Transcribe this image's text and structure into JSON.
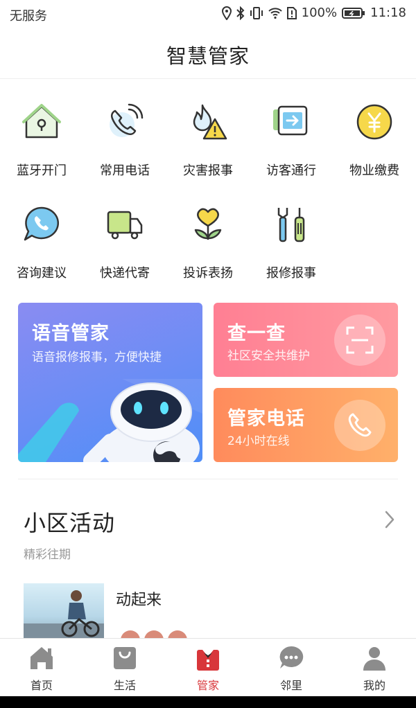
{
  "status": {
    "carrier": "无服务",
    "battery": "100%",
    "time": "11:18"
  },
  "header": {
    "title": "智慧管家"
  },
  "grid": [
    {
      "label": "蓝牙开门",
      "icon": "house-lock-icon"
    },
    {
      "label": "常用电话",
      "icon": "phone-icon"
    },
    {
      "label": "灾害报事",
      "icon": "fire-warning-icon"
    },
    {
      "label": "访客通行",
      "icon": "visitor-pass-icon"
    },
    {
      "label": "物业缴费",
      "icon": "yen-coin-icon"
    },
    {
      "label": "咨询建议",
      "icon": "chat-phone-icon"
    },
    {
      "label": "快递代寄",
      "icon": "delivery-truck-icon"
    },
    {
      "label": "投诉表扬",
      "icon": "heart-flower-icon"
    },
    {
      "label": "报修报事",
      "icon": "repair-tools-icon"
    }
  ],
  "cards": {
    "voice": {
      "title": "语音管家",
      "subtitle": "语音报修报事，方便快捷"
    },
    "check": {
      "title": "查一查",
      "subtitle": "社区安全共维护"
    },
    "phone": {
      "title": "管家电话",
      "subtitle": "24小时在线"
    }
  },
  "activity_section": {
    "title": "小区活动",
    "subtitle": "精彩往期",
    "items": [
      {
        "title": "动起来"
      }
    ]
  },
  "tabs": [
    {
      "label": "首页",
      "icon": "home-icon",
      "active": false
    },
    {
      "label": "生活",
      "icon": "shopping-bag-icon",
      "active": false
    },
    {
      "label": "管家",
      "icon": "butler-icon",
      "active": true
    },
    {
      "label": "邻里",
      "icon": "chat-bubble-icon",
      "active": false
    },
    {
      "label": "我的",
      "icon": "person-icon",
      "active": false
    }
  ],
  "colors": {
    "accent": "#d8363a",
    "icon_yellow": "#f6d84a",
    "icon_blue": "#7cc9f0",
    "icon_green": "#9fd48a"
  }
}
